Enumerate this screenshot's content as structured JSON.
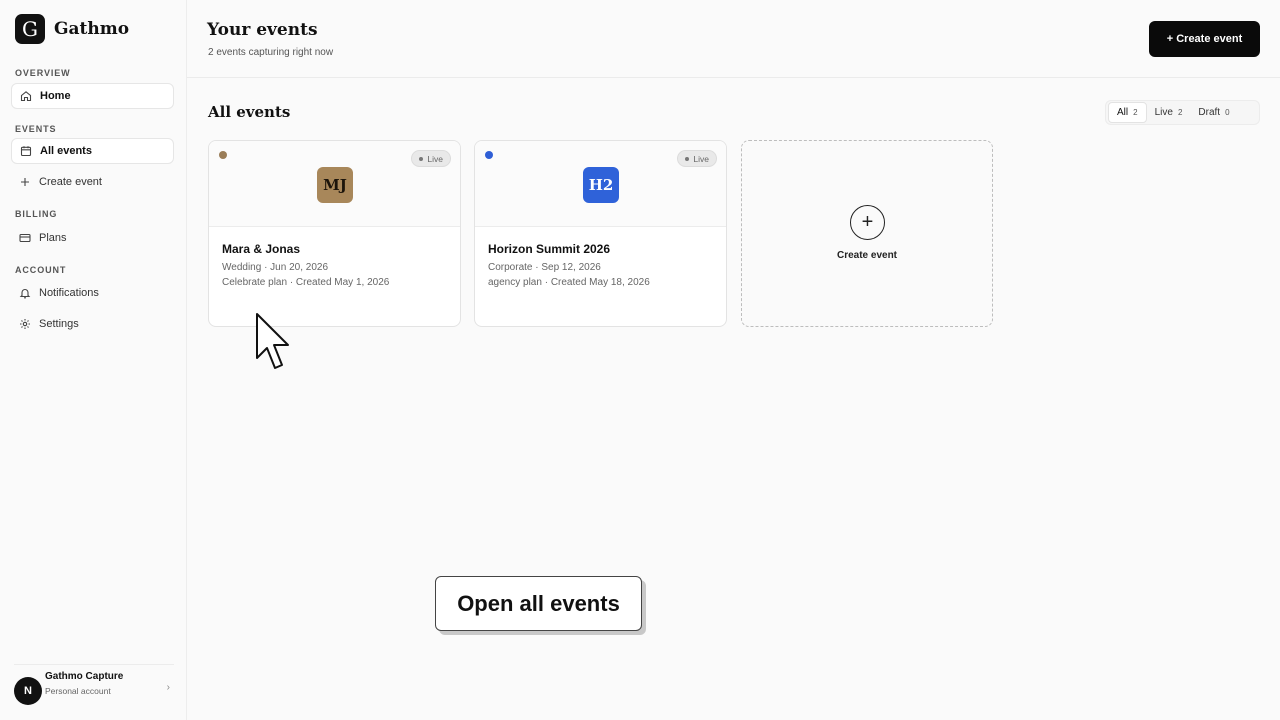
{
  "brand": {
    "mark": "G",
    "name": "Gathmo"
  },
  "sidebar": {
    "sections": [
      {
        "label": "OVERVIEW"
      },
      {
        "label": "EVENTS"
      },
      {
        "label": "BILLING"
      },
      {
        "label": "ACCOUNT"
      }
    ],
    "items": [
      {
        "label": "Home",
        "icon": "home-icon",
        "active": true
      },
      {
        "label": "All events",
        "icon": "calendar-icon",
        "active": true
      },
      {
        "label": "Create event",
        "icon": "plus-icon",
        "active": false
      },
      {
        "label": "Plans",
        "icon": "credit-card-icon",
        "active": false
      },
      {
        "label": "Notifications",
        "icon": "bell-icon",
        "active": false
      },
      {
        "label": "Settings",
        "icon": "gear-icon",
        "active": false
      }
    ],
    "account": {
      "avatar": "N",
      "name": "Gathmo Capture",
      "sub": "Personal account",
      "chevron": "›"
    }
  },
  "header": {
    "title": "Your events",
    "subtitle": "2 events capturing right now",
    "create_label": "+ Create event"
  },
  "events_section": {
    "title": "All events",
    "filters": [
      {
        "label": "All",
        "count": "2",
        "active": true
      },
      {
        "label": "Live",
        "count": "2",
        "active": false
      },
      {
        "label": "Draft",
        "count": "0",
        "active": false
      }
    ]
  },
  "events": [
    {
      "logo": "MJ",
      "logo_bg": "#a8875a",
      "logo_fg": "#1c140a",
      "dot_color": "#9a7d58",
      "status": "Live",
      "name": "Mara & Jonas",
      "meta1": "Wedding · Jun 20, 2026",
      "meta2": "Celebrate plan · Created May 1, 2026"
    },
    {
      "logo": "H2",
      "logo_bg": "#2f62d9",
      "logo_fg": "#ffffff",
      "dot_color": "#2f5fd6",
      "status": "Live",
      "name": "Horizon Summit 2026",
      "meta1": "Corporate · Sep 12, 2026",
      "meta2": "agency plan · Created May 18, 2026"
    }
  ],
  "new_event_card": {
    "icon": "+",
    "label": "Create event"
  },
  "tooltip": {
    "label": "Open all events"
  }
}
